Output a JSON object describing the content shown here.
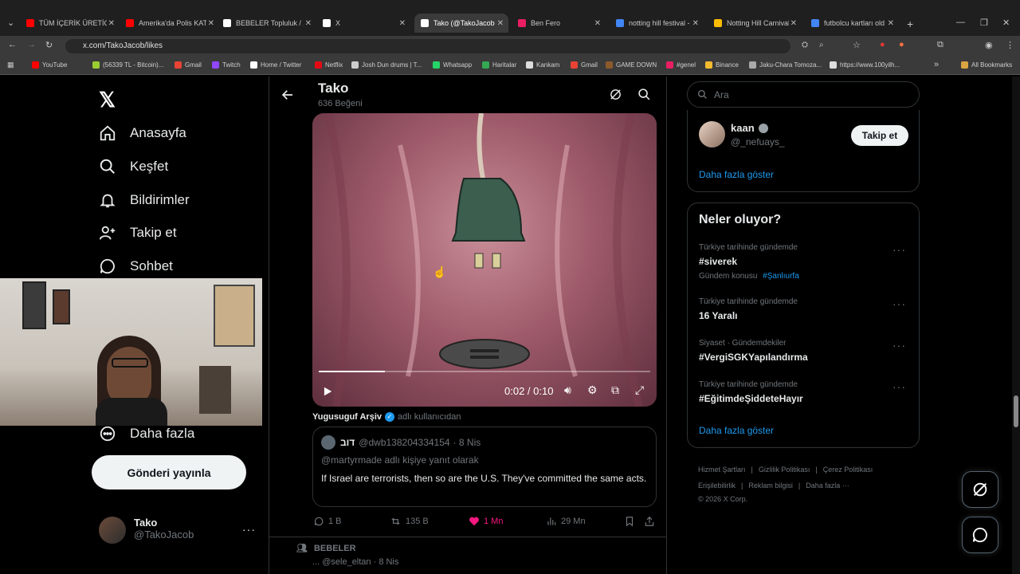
{
  "browser": {
    "tabs": [
      {
        "title": "TÜM İÇERİK ÜRETİCİL",
        "color": "#ff0000",
        "active": false
      },
      {
        "title": "Amerika'da Polis KATİ",
        "color": "#ff0000",
        "active": false
      },
      {
        "title": "BEBELER Topluluk / X",
        "color": "#ffffff",
        "active": false
      },
      {
        "title": "X",
        "color": "#ffffff",
        "active": false
      },
      {
        "title": "Tako (@TakoJacob",
        "color": "#ffffff",
        "active": true
      },
      {
        "title": "Ben Fero",
        "color": "#e91e63",
        "active": false
      },
      {
        "title": "notting hill festival - G",
        "color": "#4285f4",
        "active": false
      },
      {
        "title": "Notting Hill Carnival",
        "color": "#fbbc04",
        "active": false
      },
      {
        "title": "futbolcu kartları old",
        "color": "#4285f4",
        "active": false
      }
    ],
    "url": "x.com/TakoJacob/likes",
    "bookmarks": [
      "YouTube",
      "(56339 TL - Bitcoin)...",
      "Gmail",
      "Twitch",
      "Home / Twitter",
      "Netflix",
      "Josh Dun drums | T...",
      "Whatsapp",
      "Haritalar",
      "Kankam",
      "Gmail",
      "GAME DOWN",
      "#genel",
      "Binance",
      "Jaku-Chara Tomoza...",
      "https://www.100yilh..."
    ],
    "all_bookmarks": "All Bookmarks"
  },
  "nav": {
    "logo": "𝕏",
    "items": [
      "Anasayfa",
      "Keşfet",
      "Bildirimler",
      "Takip et",
      "Sohbet"
    ],
    "more": "Daha fazla",
    "post_button": "Gönderi yayınla",
    "profile_name": "Tako",
    "profile_handle": "@TakoJacob"
  },
  "header": {
    "title": "Tako",
    "subtitle": "636 Beğeni"
  },
  "video": {
    "time": "0:02 / 0:10",
    "progress": 0.2
  },
  "post": {
    "source": "Yugusuguf Arşiv",
    "source_suffix": "adlı kullanıcıdan",
    "quoted_name": "דוב",
    "quoted_handle": "@dwb138204334154",
    "quoted_time": "· 8 Nis",
    "reply_to": "@martyrmade adlı kişiye yanıt olarak",
    "quoted_text": "If Israel are terrorists, then so are the U.S. They've committed the same acts.",
    "replies": "1 B",
    "reposts": "135 B",
    "likes": "1 Mn",
    "views": "29 Mn"
  },
  "next_post": {
    "community": "BEBELER",
    "peek": "...  @sele_eltan · 8 Nis"
  },
  "right": {
    "search_placeholder": "Ara",
    "follow": {
      "name": "kaan",
      "handle": "@_nefuays_",
      "button": "Takip et",
      "more": "Daha fazla göster"
    },
    "trends_title": "Neler oluyor?",
    "trends": [
      {
        "context": "Türkiye tarihinde gündemde",
        "name": "#siverek",
        "extra_label": "Gündem konusu",
        "extra_link": "#Şanlıurfa"
      },
      {
        "context": "Türkiye tarihinde gündemde",
        "name": "16 Yaralı",
        "extra_label": "",
        "extra_link": ""
      },
      {
        "context": "Siyaset · Gündemdekiler",
        "name": "#VergiSGKYapılandırma",
        "extra_label": "",
        "extra_link": ""
      },
      {
        "context": "Türkiye tarihinde gündemde",
        "name": "#EğitimdeŞiddeteHayır",
        "extra_label": "",
        "extra_link": ""
      }
    ],
    "trends_more": "Daha fazla göster",
    "footer": [
      "Hizmet Şartları",
      "Gizlilik Politikası",
      "Çerez Politikası",
      "Erişilebilirlik",
      "Reklam bilgisi",
      "Daha fazla ···"
    ],
    "copyright": "© 2026 X Corp."
  }
}
